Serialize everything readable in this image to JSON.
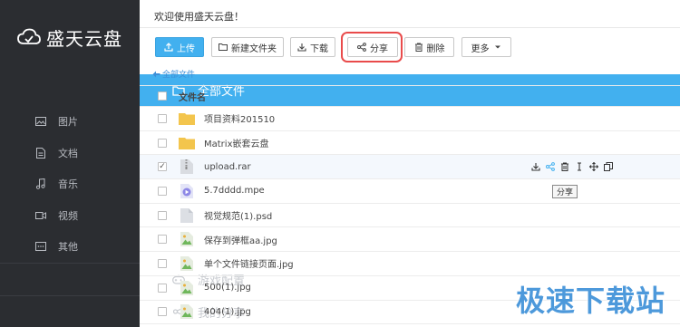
{
  "app": {
    "name": "盛天云盘"
  },
  "sidebar": {
    "items": [
      {
        "label": "全部文件",
        "icon": "folder-icon"
      },
      {
        "label": "图片",
        "icon": "image-icon"
      },
      {
        "label": "文档",
        "icon": "document-icon"
      },
      {
        "label": "音乐",
        "icon": "music-icon"
      },
      {
        "label": "视频",
        "icon": "video-icon"
      },
      {
        "label": "其他",
        "icon": "other-icon"
      },
      {
        "label": "游戏配置",
        "icon": "gamepad-icon"
      },
      {
        "label": "我的分享",
        "icon": "share-icon"
      }
    ]
  },
  "header": {
    "welcome": "欢迎使用盛天云盘！"
  },
  "toolbar": {
    "upload": "上传",
    "new_folder": "新建文件夹",
    "download": "下载",
    "share": "分享",
    "delete": "删除",
    "more": "更多"
  },
  "breadcrumb": {
    "label": "全部文件"
  },
  "table": {
    "header": "文件名",
    "rows": [
      {
        "name": "项目资料201510",
        "type": "folder",
        "checked": false
      },
      {
        "name": "Matrix嵌套云盘",
        "type": "folder",
        "checked": false
      },
      {
        "name": "upload.rar",
        "type": "archive",
        "checked": true
      },
      {
        "name": "5.7dddd.mpe",
        "type": "video",
        "checked": false
      },
      {
        "name": "视觉规范(1).psd",
        "type": "file",
        "checked": false
      },
      {
        "name": "保存到弹框aa.jpg",
        "type": "image",
        "checked": false
      },
      {
        "name": "单个文件链接页面.jpg",
        "type": "image",
        "checked": false
      },
      {
        "name": "500(1).jpg",
        "type": "image",
        "checked": false
      },
      {
        "name": "404(1).jpg",
        "type": "image",
        "checked": false
      }
    ]
  },
  "tooltip": "分享",
  "watermark": "极速下载站",
  "colors": {
    "accent": "#42b0ef",
    "sidebar_bg": "#2b2d31",
    "highlight": "#e94b4b"
  }
}
